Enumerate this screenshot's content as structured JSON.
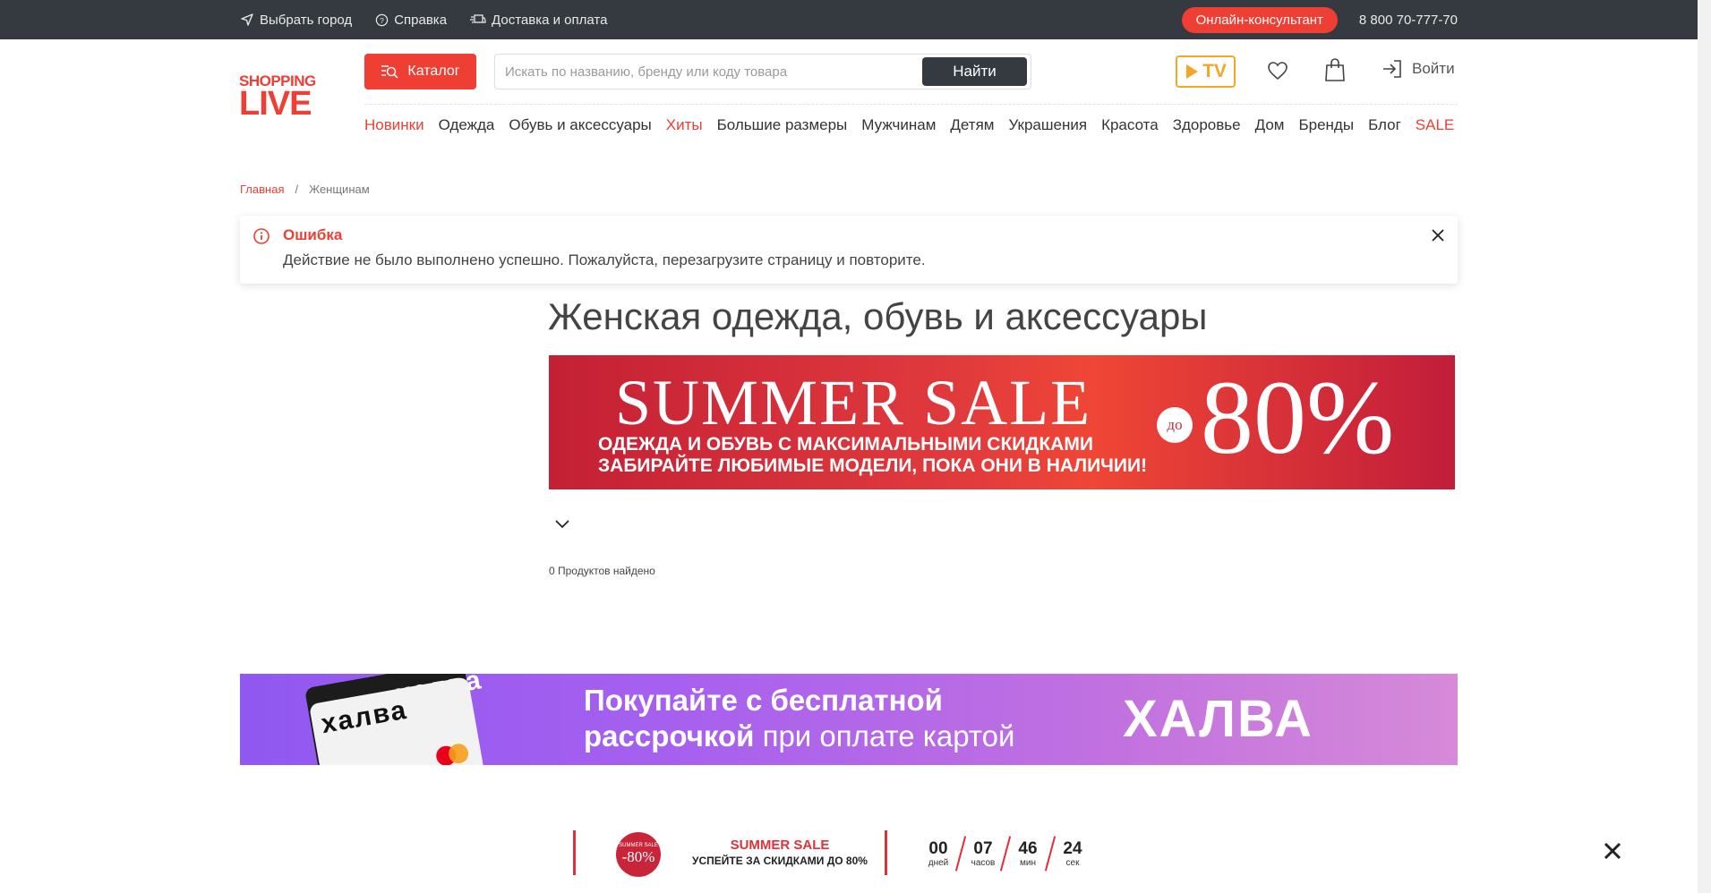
{
  "topbar": {
    "city": "Выбрать город",
    "help": "Справка",
    "delivery": "Доставка и оплата",
    "consultant": "Онлайн-консультант",
    "phone": "8 800 70-777-70"
  },
  "header": {
    "logo_line1": "SHOPPING",
    "logo_line2": "LIVE",
    "catalog_label": "Каталог",
    "search_placeholder": "Искать по названию, бренду или коду товара",
    "search_button": "Найти",
    "tv_label": "TV",
    "login_label": "Войти"
  },
  "nav": [
    {
      "label": "Новинки",
      "highlight": true
    },
    {
      "label": "Одежда",
      "highlight": false
    },
    {
      "label": "Обувь и аксессуары",
      "highlight": false
    },
    {
      "label": "Хиты",
      "highlight": true
    },
    {
      "label": "Большие размеры",
      "highlight": false
    },
    {
      "label": "Мужчинам",
      "highlight": false
    },
    {
      "label": "Детям",
      "highlight": false
    },
    {
      "label": "Украшения",
      "highlight": false
    },
    {
      "label": "Красота",
      "highlight": false
    },
    {
      "label": "Здоровье",
      "highlight": false
    },
    {
      "label": "Дом",
      "highlight": false
    },
    {
      "label": "Бренды",
      "highlight": false
    },
    {
      "label": "Блог",
      "highlight": false
    },
    {
      "label": "SALE",
      "highlight": true
    }
  ],
  "breadcrumb": {
    "home": "Главная",
    "separator": "/",
    "current": "Женщинам"
  },
  "alert": {
    "title": "Ошибка",
    "message": "Действие не было выполнено успешно. Пожалуйста, перезагрузите страницу и повторите."
  },
  "page_title": "Женская одежда, обувь и аксессуары",
  "sale_banner": {
    "headline": "SUMMER SALE",
    "line1": "ОДЕЖДА И ОБУВЬ С МАКСИМАЛЬНЫМИ СКИДКАМИ",
    "line2": "ЗАБИРАЙТЕ ЛЮБИМЫЕ МОДЕЛИ, ПОКА ОНИ В НАЛИЧИИ!",
    "prefix": "до",
    "percent": "80%"
  },
  "products_found": "0 Продуктов найдено",
  "halva_banner": {
    "text_bold_1": "Покупайте с бесплатной",
    "text_bold_2": "рассрочкой",
    "text_regular": " при оплате картой",
    "logo": "ХАЛВА",
    "card_brand": "халва"
  },
  "countdown": {
    "badge_top": "SUMMER SALE",
    "badge_value": "-80%",
    "title": "SUMMER SALE",
    "subtitle": "УСПЕЙТЕ ЗА СКИДКАМИ ДО 80%",
    "days": "00",
    "days_label": "дней",
    "hours": "07",
    "hours_label": "часов",
    "minutes": "46",
    "minutes_label": "мин",
    "seconds": "24",
    "seconds_label": "сек"
  },
  "colors": {
    "accent": "#ef3e33",
    "topbar": "#343a40",
    "tv": "#f5a623"
  }
}
